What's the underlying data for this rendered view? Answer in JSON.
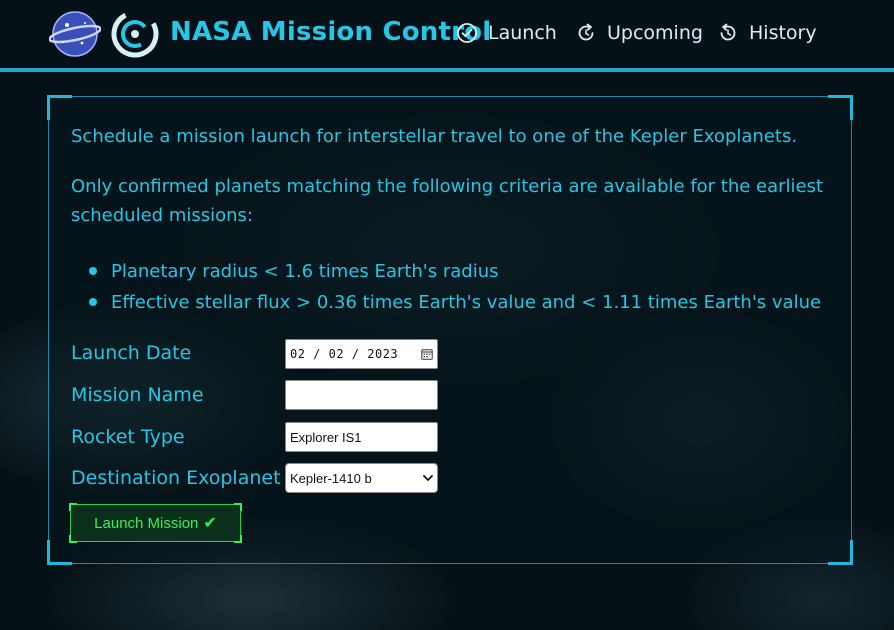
{
  "header": {
    "title": "NASA Mission Control",
    "nav": {
      "launch": "Launch",
      "upcoming": "Upcoming",
      "history": "History"
    },
    "icons": {
      "planet": "planet-logo-icon",
      "brand": "nasa-ring-logo-icon",
      "launch": "check-circle-icon",
      "upcoming": "refresh-icon",
      "history": "history-icon"
    }
  },
  "content": {
    "intro": "Schedule a mission launch for interstellar travel to one of the Kepler Exoplanets.",
    "criteria_intro": "Only confirmed planets matching the following criteria are available for the earliest scheduled missions:",
    "criteria": [
      "Planetary radius < 1.6 times Earth's radius",
      "Effective stellar flux > 0.36 times Earth's value and < 1.11 times Earth's value"
    ]
  },
  "form": {
    "launch_date": {
      "label": "Launch Date",
      "value": "02 / 02 / 2023"
    },
    "mission_name": {
      "label": "Mission Name",
      "value": ""
    },
    "rocket_type": {
      "label": "Rocket Type",
      "value": "Explorer IS1"
    },
    "destination": {
      "label": "Destination Exoplanet",
      "value": "Kepler-1410 b"
    },
    "submit_label": "Launch Mission",
    "submit_mark": "✔"
  },
  "colors": {
    "accent": "#26c6e4",
    "button_green": "#2ff25a",
    "background": "#061117"
  }
}
